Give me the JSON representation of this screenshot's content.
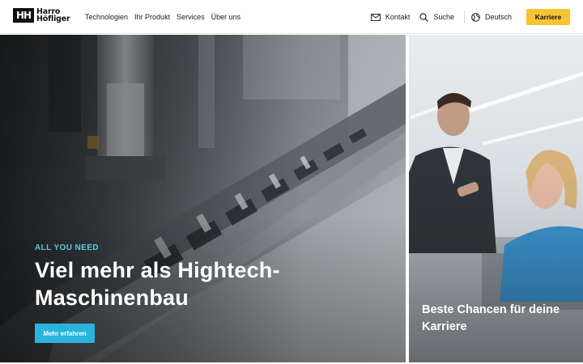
{
  "header": {
    "logo": {
      "mark": "HH",
      "line1": "Harro",
      "line2": "Höfliger"
    },
    "nav": [
      {
        "label": "Technologien"
      },
      {
        "label": "Ihr Produkt"
      },
      {
        "label": "Services"
      },
      {
        "label": "Über uns"
      }
    ],
    "utility": {
      "contact_label": "Kontakt",
      "contact_icon": "envelope-icon",
      "search_label": "Suche",
      "search_icon": "search-icon",
      "language_label": "Deutsch",
      "language_icon": "globe-icon"
    },
    "cta_label": "Karriere"
  },
  "hero": {
    "eyebrow": "ALL YOU NEED",
    "title": "Viel mehr als Hightech-Maschinenbau",
    "button_label": "Mehr erfahren"
  },
  "side_card": {
    "title": "Beste Chancen für deine Karriere"
  },
  "colors": {
    "cta_yellow": "#f7c534",
    "accent_cyan": "#2ab4dc",
    "eyebrow_cyan": "#5ac8e6",
    "logo_black": "#111111"
  }
}
